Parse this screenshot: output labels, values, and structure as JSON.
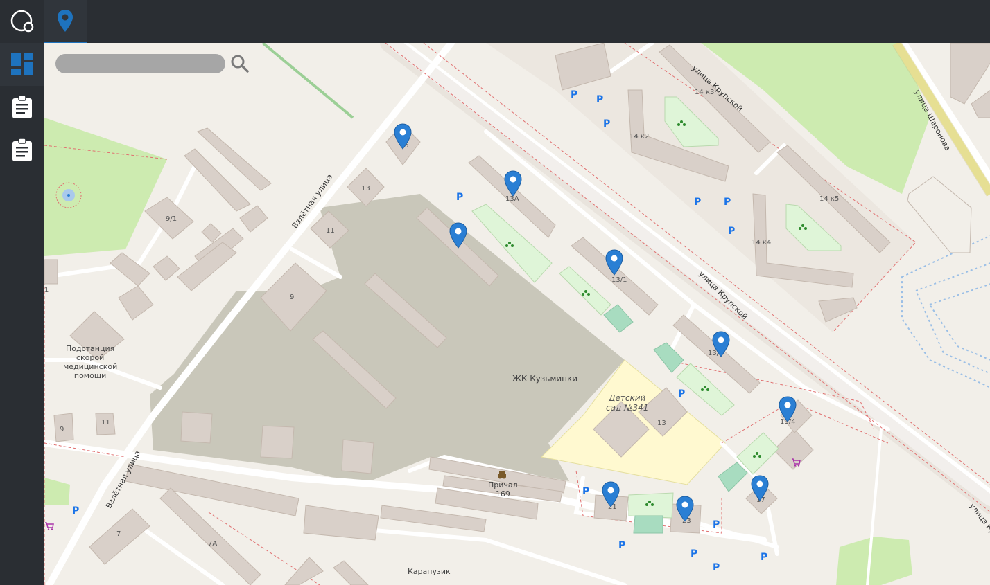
{
  "app": {
    "nav_icons": [
      "logo-icon",
      "map-pin-icon",
      "dashboard-icon",
      "clipboard-icon",
      "clipboard-icon"
    ]
  },
  "search": {
    "placeholder": "",
    "value": ""
  },
  "map": {
    "labels": {
      "b15": "15",
      "b13": "13",
      "b11": "11",
      "b91": "9/1",
      "b9": "9",
      "b13a": "13А",
      "b131": "13/1",
      "b133": "13/3",
      "b134": "13/4",
      "b14k3": "14 к3",
      "b14k2": "14 к2",
      "b14k5": "14 к5",
      "b14k4": "14 к4",
      "b13kg": "13",
      "b21": "21",
      "b23": "23",
      "b17": "17",
      "b9w": "9",
      "b11w": "11",
      "b7": "7",
      "b7a": "7А",
      "b1": "1",
      "zhk": "ЖК Кузьминки",
      "kindergarten": "Детский\nсад №341",
      "ambulance": "Подстанция\nскорой\nмедицинской\nпомощи",
      "prichal": "Причал\n169",
      "karapuzik": "Карапузик"
    },
    "streets": {
      "vzletnaya_top": "Взлётная улица",
      "vzletnaya_bottom": "Взлётная улица",
      "krupskoy_top": "улица Крупской",
      "krupskoy_mid": "улица Крупской",
      "krupskoy_bottom": "улица Крупской",
      "sharonova": "улица Шаронова"
    },
    "parking_symbol": "P",
    "colors": {
      "marker": "#2a7fd4",
      "topbar": "#2a2e33",
      "accent": "#1e73be"
    }
  }
}
